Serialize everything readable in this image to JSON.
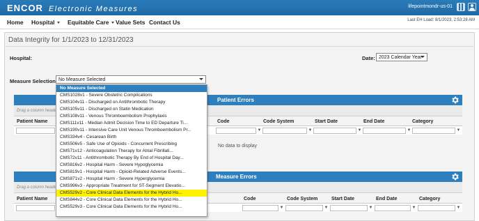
{
  "brand": {
    "name": "ENCOR",
    "subtitle": "Electronic Measures"
  },
  "user": {
    "name": "lifepointmondr-us-01"
  },
  "icons": {
    "grid": "grid-icon",
    "user": "user-icon",
    "gear": "gear-icon",
    "filter": "filter-icon",
    "caret": "chevron-down-icon"
  },
  "colors": {
    "brand_blue": "#2d7fbe",
    "highlight": "#fff200"
  },
  "nav": {
    "items": [
      {
        "label": "Home"
      },
      {
        "label": "Hospital"
      },
      {
        "label": "Equitable Care"
      },
      {
        "label": "Value Sets"
      },
      {
        "label": "Contact Us"
      }
    ],
    "last_load": "Last EH Load: 8/1/2023, 2:53:28 AM"
  },
  "page": {
    "title": "Data Integrity for 1/1/2023 to 12/31/2023"
  },
  "filters": {
    "hospital_label": "Hospital:",
    "date_label": "Date:",
    "date_value": "2023 Calendar Year",
    "measure_label": "Measure Selection:",
    "measure_value": "No Measure Selected"
  },
  "panels": {
    "patient_errors": {
      "title": "Patient Errors",
      "drag_hint": "Drag a column header here to group by that column",
      "columns": [
        "Patient Name",
        "Code",
        "Code System",
        "Start Date",
        "End Date",
        "Category"
      ],
      "empty_text": "No data to display"
    },
    "measure_errors": {
      "title": "Measure Errors",
      "drag_hint": "Drag a column header here to group by that column",
      "columns": [
        "Patient Name",
        "Code",
        "Code System",
        "Start Date",
        "End Date",
        "Category"
      ]
    }
  },
  "dropdown": {
    "options": [
      "No Measure Selected",
      "CMS1028v1 - Severe Obstetric Complications",
      "CMS104v11 - Discharged on Antithrombotic Therapy",
      "CMS105v11 - Discharged on Statin Medication",
      "CMS108v11 - Venous Thromboembolism Prophylaxis",
      "CMS111v11 - Median Admit Decision Time to ED Departure Ti...",
      "CMS190v11 - Intensive Care Unit Venous Thromboembolism Pr...",
      "CMS334v4 - Cesarean Birth",
      "CMS506v5 - Safe Use of Opioids - Concurrent Prescribing",
      "CMS71v12 - Anticoagulation Therapy for Atrial Fibrillati...",
      "CMS72v11 - Antithrombotic Therapy By End of Hospital Day...",
      "CMS816v2 - Hospital Harm - Severe Hypoglycemia",
      "CMS819v1 - Hospital Harm - Opioid-Related Adverse Events...",
      "CMS871v2 - Hospital Harm - Severe Hyperglycemia",
      "CMS996v3 - Appropriate Treatment for ST-Segment Elevatio...",
      "CMS529v2 - Core Clinical Data Elements for the Hybrid Ho...",
      "CMS844v2 - Core Clinical Data Elements for the Hybrid Ho...",
      "CMS529v3 - Core Clinical Data Elements for the Hybrid Ho..."
    ],
    "selected_index": 0,
    "highlighted_index": 15
  }
}
